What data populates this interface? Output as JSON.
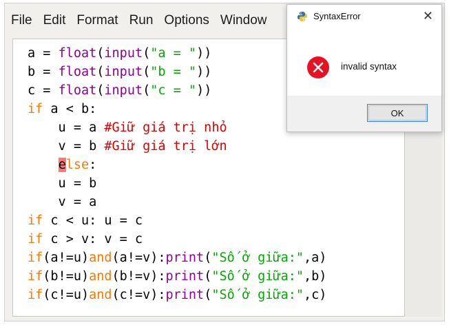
{
  "menubar": {
    "items": [
      "File",
      "Edit",
      "Format",
      "Run",
      "Options",
      "Window"
    ]
  },
  "code": {
    "lines": [
      [
        {
          "t": "a = ",
          "c": ""
        },
        {
          "t": "float",
          "c": "bi"
        },
        {
          "t": "(",
          "c": ""
        },
        {
          "t": "input",
          "c": "bi"
        },
        {
          "t": "(",
          "c": ""
        },
        {
          "t": "\"a = \"",
          "c": "st"
        },
        {
          "t": "))",
          "c": ""
        }
      ],
      [
        {
          "t": "b = ",
          "c": ""
        },
        {
          "t": "float",
          "c": "bi"
        },
        {
          "t": "(",
          "c": ""
        },
        {
          "t": "input",
          "c": "bi"
        },
        {
          "t": "(",
          "c": ""
        },
        {
          "t": "\"b = \"",
          "c": "st"
        },
        {
          "t": "))",
          "c": ""
        }
      ],
      [
        {
          "t": "c = ",
          "c": ""
        },
        {
          "t": "float",
          "c": "bi"
        },
        {
          "t": "(",
          "c": ""
        },
        {
          "t": "input",
          "c": "bi"
        },
        {
          "t": "(",
          "c": ""
        },
        {
          "t": "\"c = \"",
          "c": "st"
        },
        {
          "t": "))",
          "c": ""
        }
      ],
      [
        {
          "t": "if",
          "c": "kw"
        },
        {
          "t": " a < b:",
          "c": ""
        }
      ],
      [
        {
          "t": "    u = a ",
          "c": ""
        },
        {
          "t": "#Giữ giá trị nhỏ",
          "c": "cm"
        }
      ],
      [
        {
          "t": "    v = b ",
          "c": ""
        },
        {
          "t": "#Giữ giá trị lớn",
          "c": "cm"
        }
      ],
      [
        {
          "t": "    ",
          "c": ""
        },
        {
          "t": "e",
          "c": "err"
        },
        {
          "t": "lse",
          "c": "kw"
        },
        {
          "t": ":",
          "c": ""
        }
      ],
      [
        {
          "t": "    u = b",
          "c": ""
        }
      ],
      [
        {
          "t": "    v = a",
          "c": ""
        }
      ],
      [
        {
          "t": "if",
          "c": "kw"
        },
        {
          "t": " c < u: u = c",
          "c": ""
        }
      ],
      [
        {
          "t": "if",
          "c": "kw"
        },
        {
          "t": " c > v: v = c",
          "c": ""
        }
      ],
      [
        {
          "t": "if",
          "c": "kw"
        },
        {
          "t": "(a!=u)",
          "c": ""
        },
        {
          "t": "and",
          "c": "kw"
        },
        {
          "t": "(a!=v):",
          "c": ""
        },
        {
          "t": "print",
          "c": "bi"
        },
        {
          "t": "(",
          "c": ""
        },
        {
          "t": "\"Số ở giữa:\"",
          "c": "st"
        },
        {
          "t": ",a)",
          "c": ""
        }
      ],
      [
        {
          "t": "if",
          "c": "kw"
        },
        {
          "t": "(b!=u)",
          "c": ""
        },
        {
          "t": "and",
          "c": "kw"
        },
        {
          "t": "(b!=v):",
          "c": ""
        },
        {
          "t": "print",
          "c": "bi"
        },
        {
          "t": "(",
          "c": ""
        },
        {
          "t": "\"Số ở giữa:\"",
          "c": "st"
        },
        {
          "t": ",b)",
          "c": ""
        }
      ],
      [
        {
          "t": "if",
          "c": "kw"
        },
        {
          "t": "(c!=u)",
          "c": ""
        },
        {
          "t": "and",
          "c": "kw"
        },
        {
          "t": "(c!=v):",
          "c": ""
        },
        {
          "t": "print",
          "c": "bi"
        },
        {
          "t": "(",
          "c": ""
        },
        {
          "t": "\"Số ở giữa:\"",
          "c": "st"
        },
        {
          "t": ",c)",
          "c": ""
        }
      ]
    ]
  },
  "dialog": {
    "title": "SyntaxError",
    "message": "invalid syntax",
    "ok_label": "OK",
    "close_glyph": "✕",
    "app_icon": "python-icon",
    "message_icon": "error-icon"
  },
  "colors": {
    "keyword": "#ff7700",
    "builtin": "#900090",
    "string": "#00aa00",
    "comment": "#dd0000",
    "error_highlight": "#ff7777",
    "error_icon": "#e81123"
  }
}
